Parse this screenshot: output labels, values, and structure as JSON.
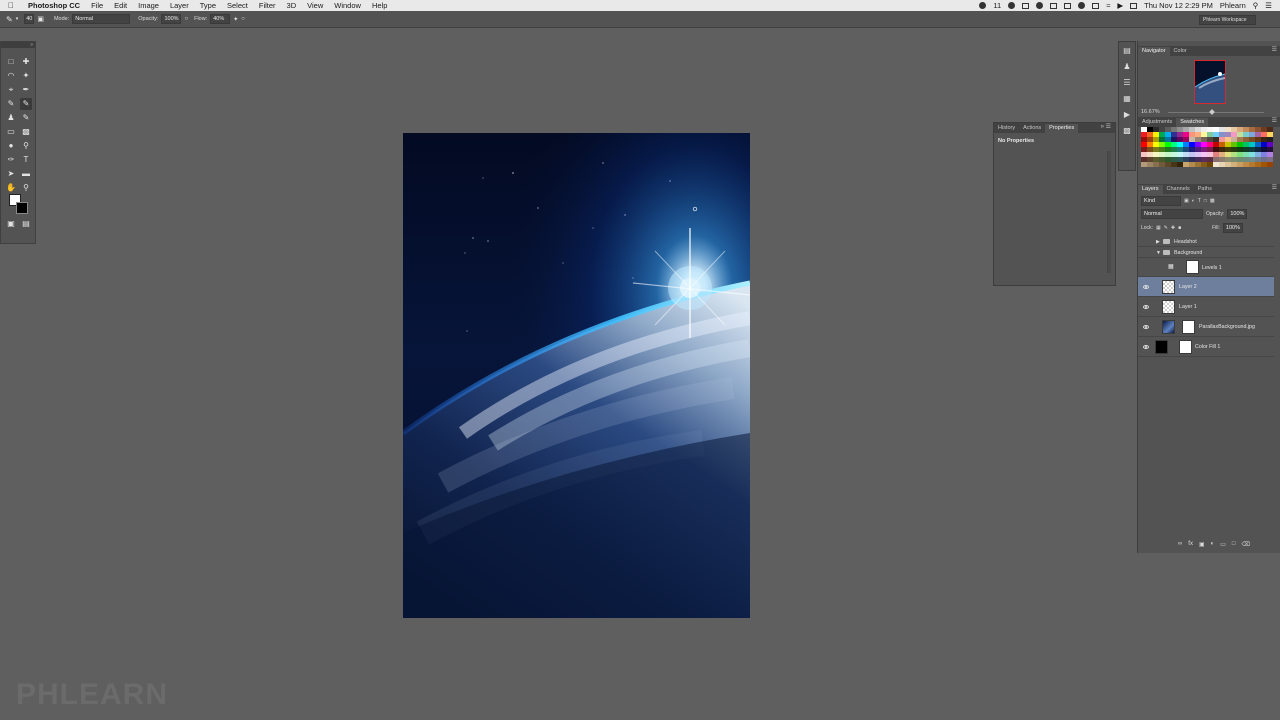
{
  "menubar": {
    "app_name": "Photoshop CC",
    "items": [
      "File",
      "Edit",
      "Image",
      "Layer",
      "Type",
      "Select",
      "Filter",
      "3D",
      "View",
      "Window",
      "Help"
    ],
    "status": {
      "badge_count": "11",
      "datetime": "Thu Nov 12  2:29 PM",
      "user": "Phlearn"
    }
  },
  "optionsbar": {
    "brush_size": "40",
    "mode_label": "Mode:",
    "mode_value": "Normal",
    "opacity_label": "Opacity:",
    "opacity_value": "100%",
    "flow_label": "Flow:",
    "flow_value": "40%",
    "workspace": "Phlearn Workspace"
  },
  "properties_panel": {
    "tabs": [
      "History",
      "Actions",
      "Properties"
    ],
    "active_tab": "Properties",
    "content": "No Properties"
  },
  "navigator": {
    "tabs": [
      "Navigator",
      "Color"
    ],
    "zoom": "16.67%"
  },
  "swatches": {
    "tabs": [
      "Adjustments",
      "Swatches"
    ],
    "colors": [
      "#ffffff",
      "#000000",
      "#2b2b2b",
      "#444444",
      "#5c5c5c",
      "#767676",
      "#8f8f8f",
      "#a8a8a8",
      "#c2c2c2",
      "#dbdbdb",
      "#ededed",
      "#f7f7f7",
      "#ffffff",
      "#e4e4e4",
      "#f2e0c9",
      "#e8c9a6",
      "#d7a97d",
      "#c48b5c",
      "#a86b3f",
      "#8d5230",
      "#6c3b22",
      "#4b2716",
      "#ed1c24",
      "#f26522",
      "#fff200",
      "#00a651",
      "#00aeef",
      "#2e3192",
      "#92278f",
      "#ec008c",
      "#f7977a",
      "#fbad82",
      "#fff799",
      "#82ca9c",
      "#6dcff6",
      "#8393ca",
      "#a186be",
      "#f49ac2",
      "#c4df9b",
      "#7accc8",
      "#7da7d9",
      "#a863a2",
      "#ff6f61",
      "#ffd35c",
      "#9e0b0f",
      "#a0410d",
      "#aba000",
      "#007236",
      "#0076a3",
      "#1b1464",
      "#630460",
      "#9e005d",
      "#c6b8a8",
      "#998675",
      "#736357",
      "#534741",
      "#37302a",
      "#f5989d",
      "#fdc689",
      "#c7b299",
      "#a67c52",
      "#8c6239",
      "#754c24",
      "#603913",
      "#3c2415",
      "#231f20",
      "#ff0000",
      "#ff8000",
      "#ffff00",
      "#80ff00",
      "#00ff00",
      "#00ff80",
      "#00ffff",
      "#0080ff",
      "#0000ff",
      "#8000ff",
      "#ff00ff",
      "#ff0080",
      "#c40000",
      "#c46200",
      "#c4c400",
      "#62c400",
      "#00c400",
      "#00c462",
      "#00c4c4",
      "#0062c4",
      "#0000c4",
      "#6200c4",
      "#7a1c1c",
      "#7a4b1c",
      "#7a7a1c",
      "#4b7a1c",
      "#1c7a1c",
      "#1c7a4b",
      "#1c7a7a",
      "#1c4b7a",
      "#1c1c7a",
      "#4b1c7a",
      "#7a1c7a",
      "#7a1c4b",
      "#3d0e0e",
      "#3d250e",
      "#3d3d0e",
      "#253d0e",
      "#0e3d0e",
      "#0e3d25",
      "#0e3d3d",
      "#0e253d",
      "#0e0e3d",
      "#250e3d",
      "#f6c3c3",
      "#f6dcc3",
      "#f6f6c3",
      "#dcf6c3",
      "#c3f6c3",
      "#c3f6dc",
      "#c3f6f6",
      "#c3dcf6",
      "#c3c3f6",
      "#dcc3f6",
      "#f6c3f6",
      "#f6c3dc",
      "#e08080",
      "#e0b080",
      "#e0e080",
      "#b0e080",
      "#80e080",
      "#80e0b0",
      "#80e0e0",
      "#80b0e0",
      "#8080e0",
      "#b080e0",
      "#5a2d2d",
      "#5a442d",
      "#5a5a2d",
      "#445a2d",
      "#2d5a2d",
      "#2d5a44",
      "#2d5a5a",
      "#2d445a",
      "#2d2d5a",
      "#442d5a",
      "#5a2d5a",
      "#5a2d44",
      "#8c6e6e",
      "#8c7d6e",
      "#8c8c6e",
      "#7d8c6e",
      "#6e8c6e",
      "#6e8c7d",
      "#6e8c8c",
      "#6e7d8c",
      "#6e6e8c",
      "#7d6e8c",
      "#b39b7a",
      "#9c8465",
      "#86704f",
      "#6f5b3b",
      "#5a4828",
      "#463617",
      "#342506",
      "#c8a46e",
      "#b38b4f",
      "#9c7433",
      "#845d1a",
      "#6d4705",
      "#f0e6d2",
      "#e6d4b4",
      "#dcc298",
      "#d2b07c",
      "#c89e62",
      "#be8c48",
      "#b47a30",
      "#aa6818",
      "#a05602",
      "#964400"
    ]
  },
  "layers": {
    "tabs": [
      "Layers",
      "Channels",
      "Paths"
    ],
    "filter_kind": "Kind",
    "blend_mode": "Normal",
    "opacity_label": "Opacity:",
    "opacity_value": "100%",
    "lock_label": "Lock:",
    "fill_label": "Fill:",
    "fill_value": "100%",
    "items": [
      {
        "name": "Headshot",
        "type": "group",
        "visible": false
      },
      {
        "name": "Background",
        "type": "group",
        "visible": false
      },
      {
        "name": "Levels 1",
        "type": "adjustment",
        "visible": false
      },
      {
        "name": "Layer 2",
        "type": "pixel",
        "visible": true,
        "selected": true
      },
      {
        "name": "Layer 1",
        "type": "pixel",
        "visible": true
      },
      {
        "name": "ParallaxBackground.jpg",
        "type": "image",
        "visible": true
      },
      {
        "name": "Color Fill 1",
        "type": "fill",
        "visible": true
      }
    ]
  },
  "watermark": "PHLEARN"
}
